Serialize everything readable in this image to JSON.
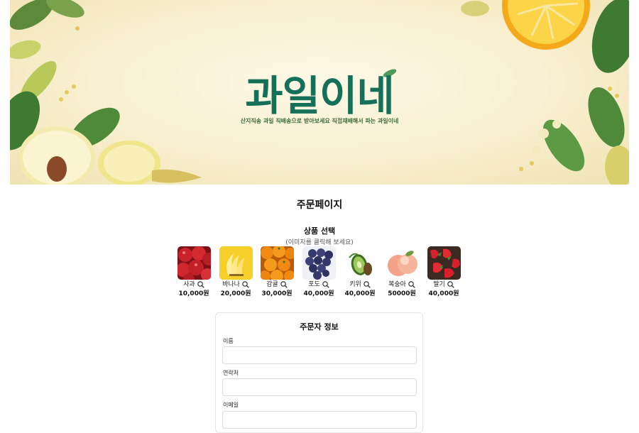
{
  "banner": {
    "title": "과일이네",
    "subtitle": "산지직송 과일 직배송으로 받아보세요 직접재배해서 파는 과일이네",
    "colors": {
      "title": "#15705a",
      "subtitle": "#3f6b3c",
      "background": "#f8efcf"
    }
  },
  "page_title": "주문페이지",
  "product_section": {
    "title": "상품 선택",
    "hint": "(이미지를 클릭해 보세요)",
    "products": [
      {
        "name": "사과",
        "price": "10,000원",
        "icon": "apple-icon",
        "color": "#c8232c"
      },
      {
        "name": "바나나",
        "price": "20,000원",
        "icon": "banana-icon",
        "color": "#f7cf2a"
      },
      {
        "name": "감귤",
        "price": "30,000원",
        "icon": "tangerine-icon",
        "color": "#f08a12"
      },
      {
        "name": "포도",
        "price": "40,000원",
        "icon": "grape-icon",
        "color": "#34386a"
      },
      {
        "name": "키위",
        "price": "40,000원",
        "icon": "kiwi-icon",
        "color": "#7aa84a"
      },
      {
        "name": "복숭아",
        "price": "50000원",
        "icon": "peach-icon",
        "color": "#f4a38a"
      },
      {
        "name": "딸기",
        "price": "40,000원",
        "icon": "strawberry-icon",
        "color": "#d7202b"
      }
    ]
  },
  "orderer": {
    "title": "주문자 정보",
    "fields": [
      {
        "label": "이름",
        "value": "",
        "placeholder": ""
      },
      {
        "label": "연락처",
        "value": "",
        "placeholder": ""
      },
      {
        "label": "이메일",
        "value": "",
        "placeholder": ""
      }
    ]
  }
}
